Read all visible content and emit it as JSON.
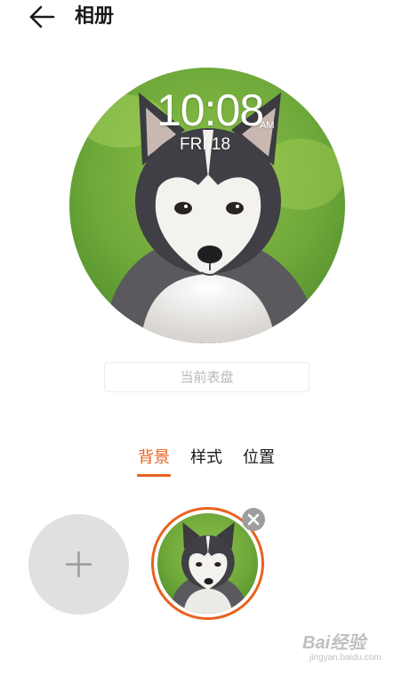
{
  "header": {
    "title": "相册",
    "back_icon": "arrow-left-icon"
  },
  "watch_face": {
    "time": "10:08",
    "ampm": "AM",
    "date": "FRI 18",
    "image": "husky-puppy-on-grass"
  },
  "current_face_label": "当前表盘",
  "tabs": [
    {
      "label": "背景",
      "active": true
    },
    {
      "label": "样式",
      "active": false
    },
    {
      "label": "位置",
      "active": false
    }
  ],
  "gallery": {
    "add_icon": "plus-icon",
    "remove_icon": "close-icon",
    "items": [
      {
        "image": "husky-puppy-on-grass",
        "selected": true
      }
    ]
  },
  "watermark": {
    "brand": "Bai经验",
    "url": "jingyan.baidu.com"
  },
  "colors": {
    "accent": "#e8621f",
    "text": "#1a1a1a",
    "placeholder": "#b8b8b8",
    "add_bg": "#e0e0e0"
  }
}
